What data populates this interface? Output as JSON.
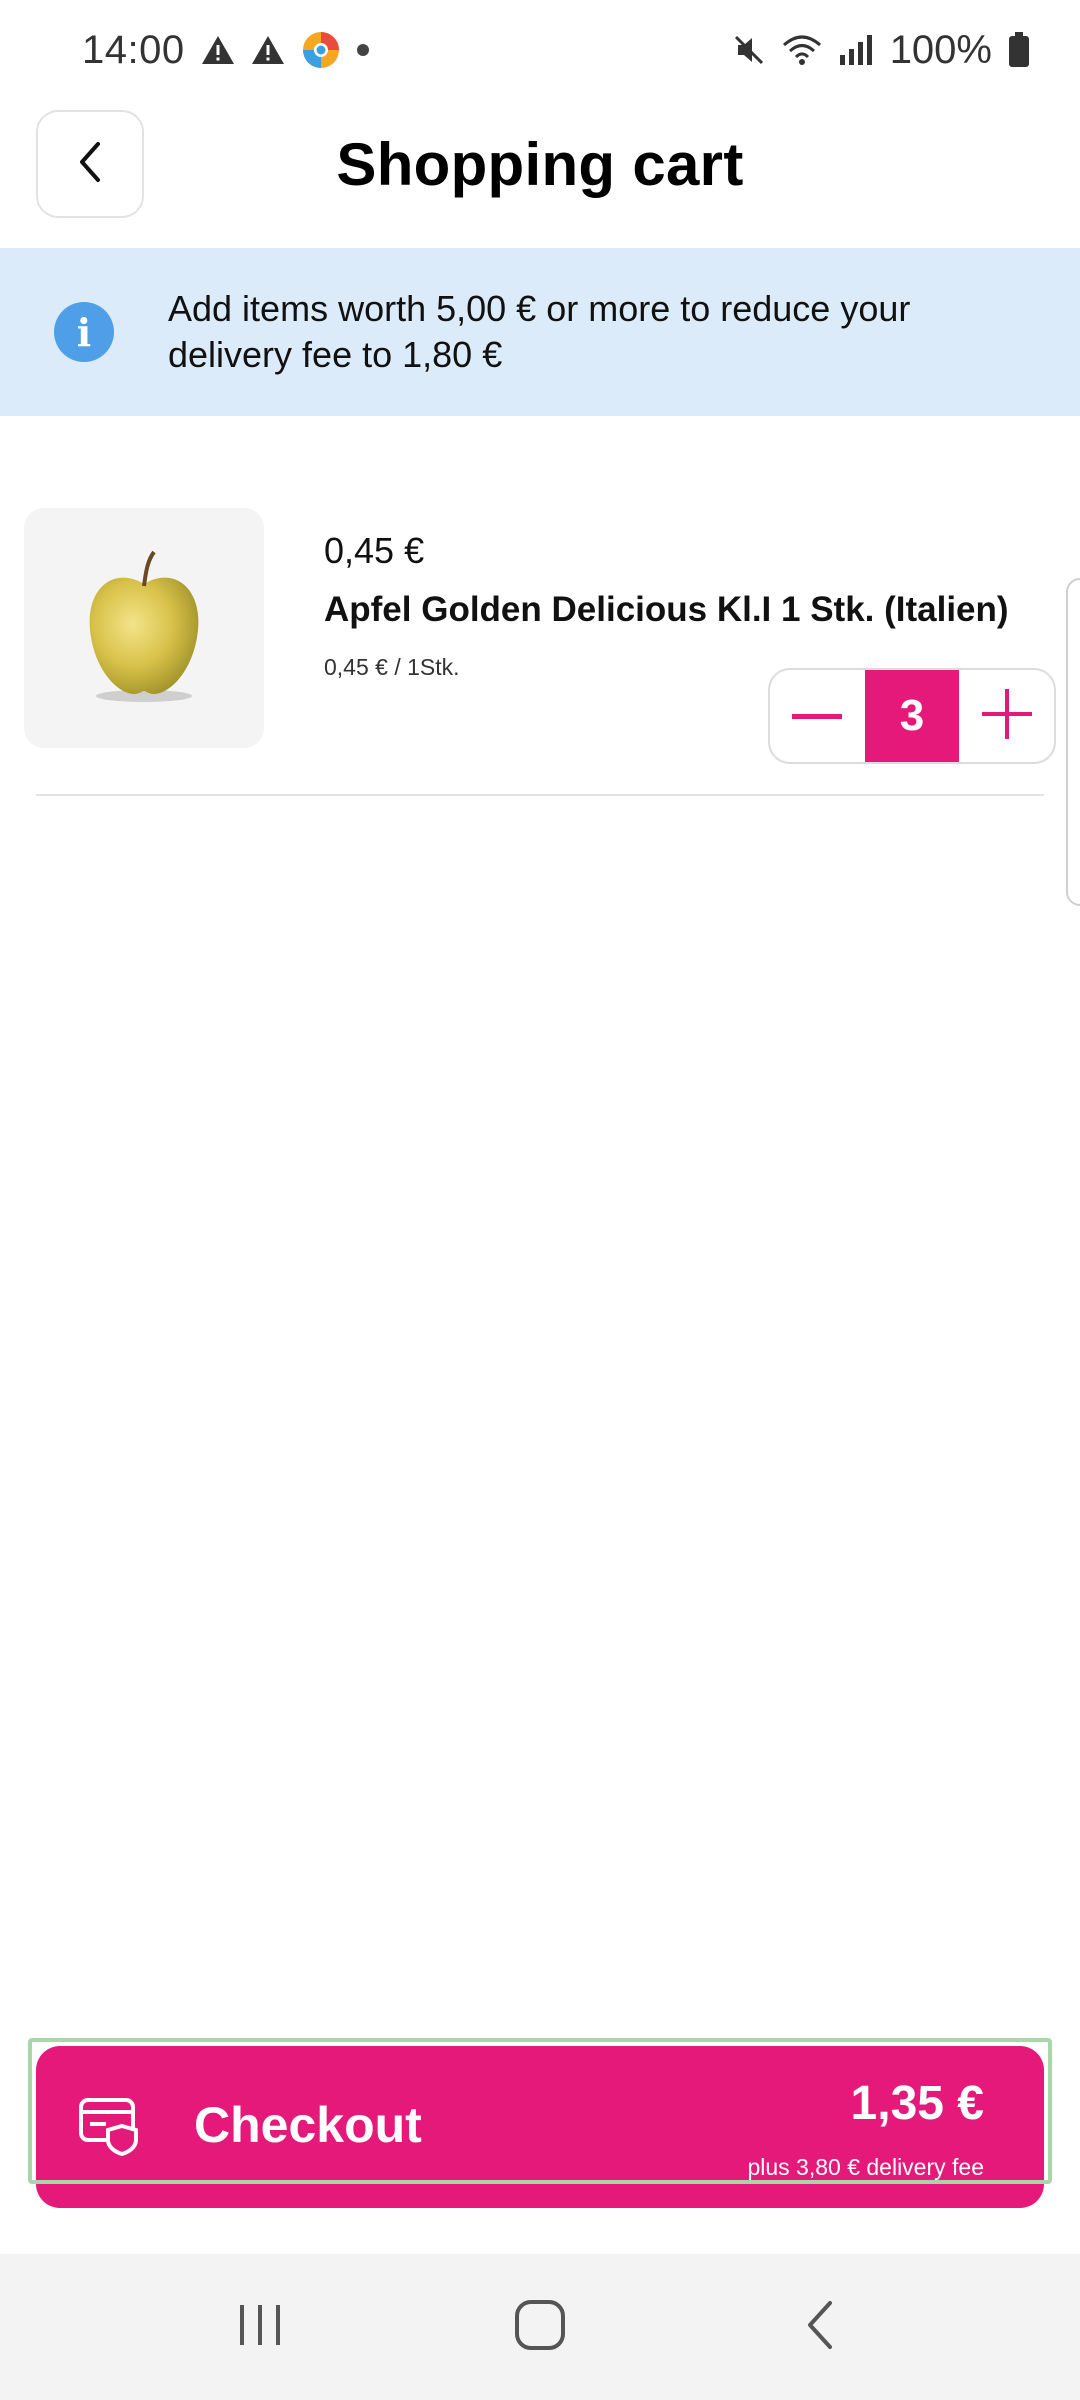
{
  "status_bar": {
    "time": "14:00",
    "battery": "100%",
    "left_icons": [
      "warning-icon",
      "warning-icon",
      "chrome-icon",
      "notification-dot"
    ],
    "right_icons": [
      "mute-icon",
      "wifi-icon",
      "signal-icon",
      "battery-icon"
    ]
  },
  "header": {
    "title": "Shopping cart",
    "back_icon": "chevron-left-icon"
  },
  "banner": {
    "icon": "info-icon",
    "icon_glyph": "i",
    "text": "Add items worth 5,00 € or more to reduce your delivery fee to 1,80 €",
    "color": "#dcebf9"
  },
  "cart": {
    "items": [
      {
        "price": "0,45 €",
        "name": "Apfel Golden Delicious Kl.I 1 Stk. (Italien)",
        "unit_price": "0,45 € / 1Stk.",
        "quantity": "3",
        "image": "apple-image"
      }
    ]
  },
  "checkout": {
    "label": "Checkout",
    "total": "1,35 €",
    "fee_note": "plus 3,80 € delivery fee",
    "icon": "secure-card-icon",
    "color": "#e5197a"
  },
  "nav_bar": {
    "buttons": [
      "recent-apps-icon",
      "home-icon",
      "back-icon"
    ]
  },
  "colors": {
    "accent": "#e5197a",
    "info_icon": "#4f9ee8",
    "banner_bg": "#dcebf9"
  }
}
